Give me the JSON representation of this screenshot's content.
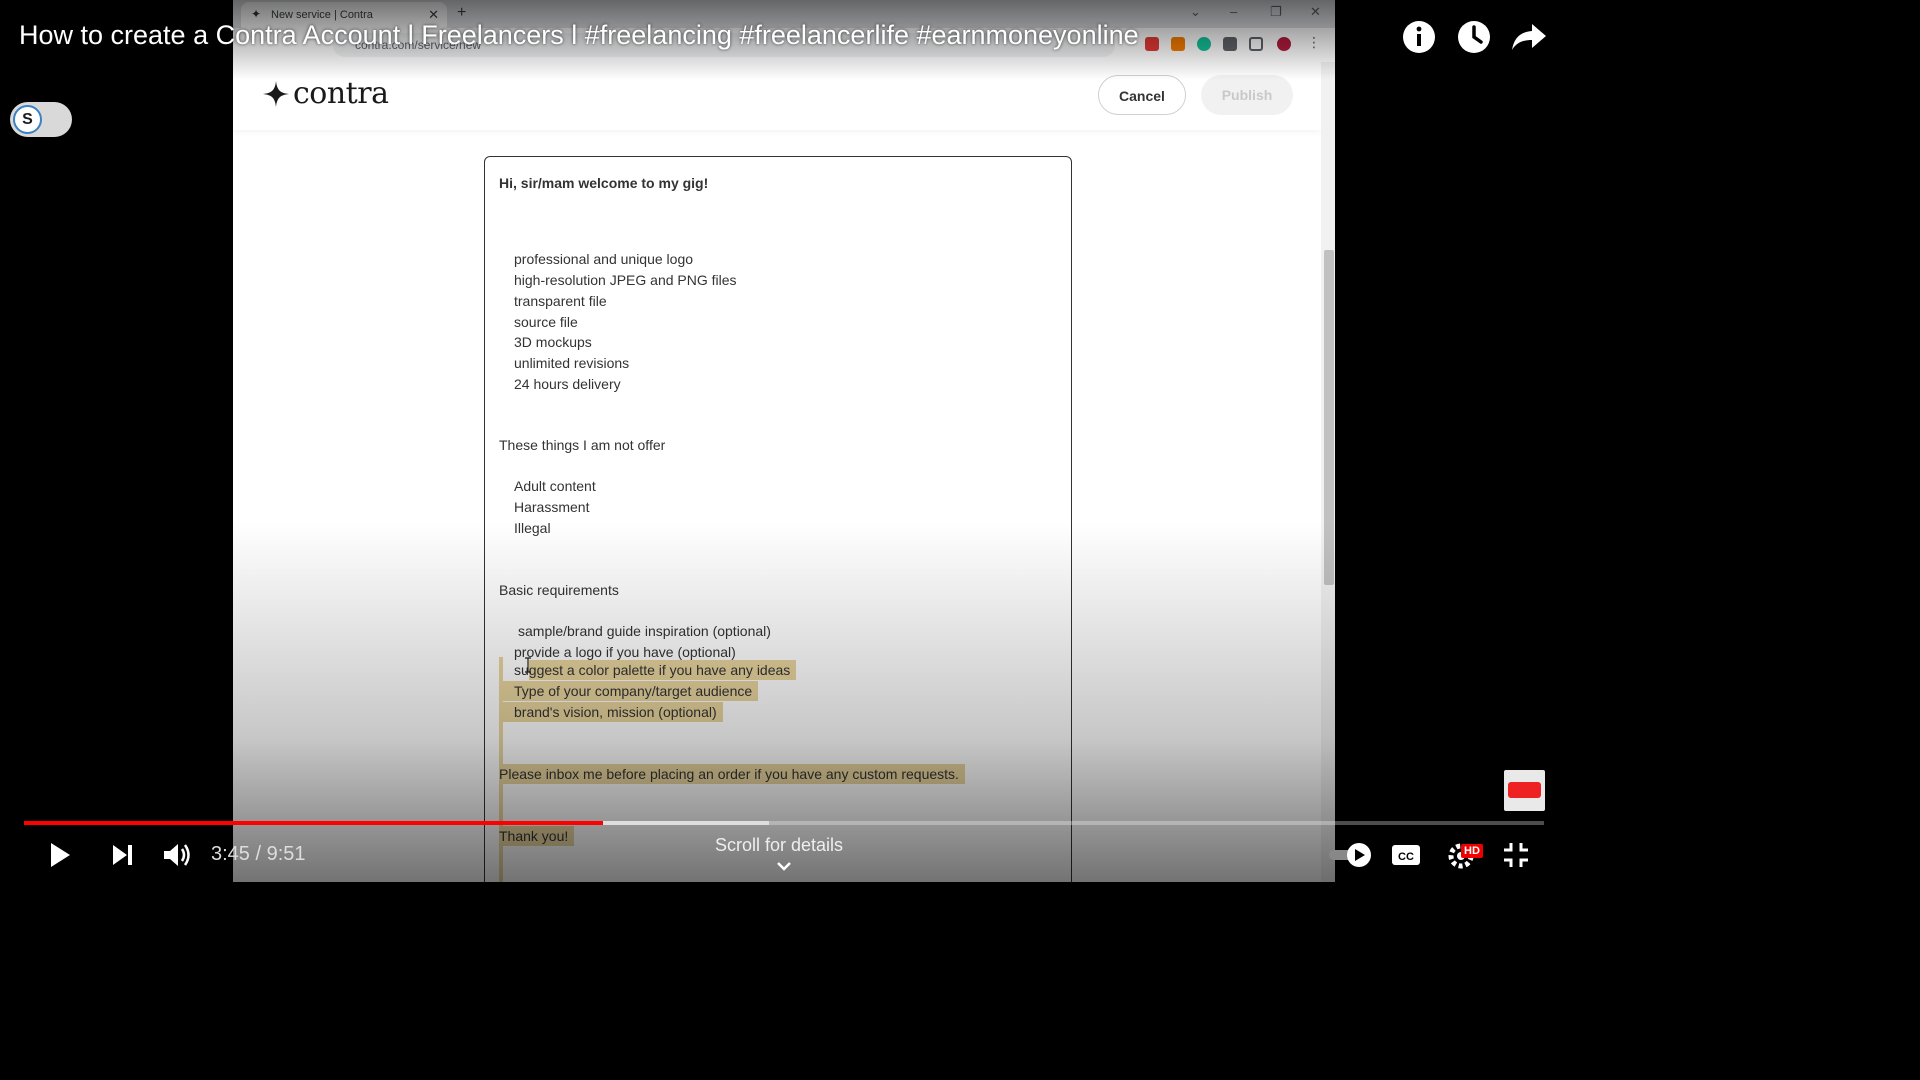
{
  "browser": {
    "tab_title": "New service | Contra",
    "url": "contra.com/service/new"
  },
  "app": {
    "logo_text": "contra",
    "cancel_label": "Cancel",
    "publish_label": "Publish"
  },
  "editor": {
    "greeting": "Hi, sir/mam welcome to my gig!",
    "offer_items": [
      "professional and unique logo",
      "high-resolution JPEG and PNG files",
      "transparent file",
      "source file",
      "3D mockups",
      "unlimited revisions",
      "24 hours delivery"
    ],
    "not_offer_heading": "These things I am not offer",
    "not_offer_items": [
      "Adult content",
      "Harassment",
      "Illegal"
    ],
    "requirements_heading": "Basic requirements",
    "requirement_items": [
      "sample/brand guide inspiration (optional)",
      "provide a logo if you have (optional)",
      "suggest a color palette if you have any ideas",
      "Type of your company/target audience",
      "brand's vision, mission (optional)"
    ],
    "inbox_note": "Please inbox me before placing an order if you have any custom requests.",
    "thanks": "Thank you!"
  },
  "player": {
    "title": "How to create a Contra Account l Freelancers l #freelancing #freelancerlife #earnmoneyonline",
    "toggle_letter": "S",
    "time": "3:45 / 9:51",
    "scroll_hint": "Scroll for details",
    "progress_fraction": 0.381,
    "buffered_fraction": 0.49,
    "hd_badge": "HD",
    "icons": [
      "info-icon",
      "clock-icon",
      "share-icon",
      "play-icon",
      "next-icon",
      "volume-icon",
      "autoplay-toggle-icon",
      "captions-icon",
      "settings-icon",
      "exit-fullscreen-icon"
    ]
  },
  "colors": {
    "progress_red": "#ff0000",
    "highlight": "#e8d59e"
  }
}
